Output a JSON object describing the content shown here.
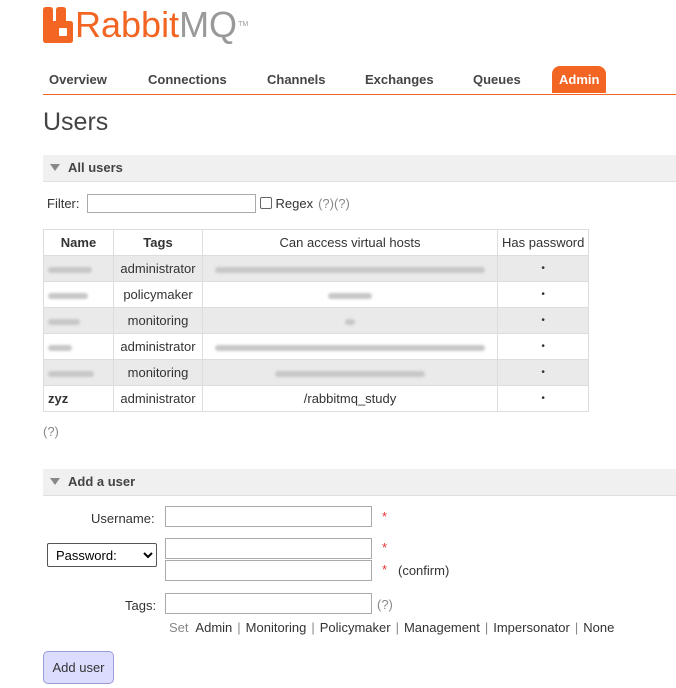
{
  "logo": {
    "rabbit": "Rabbit",
    "mq": "MQ",
    "tm": "TM"
  },
  "nav": {
    "overview": "Overview",
    "connections": "Connections",
    "channels": "Channels",
    "exchanges": "Exchanges",
    "queues": "Queues",
    "admin": "Admin"
  },
  "page_title": "Users",
  "all_users": {
    "header": "All users",
    "filter_label": "Filter:",
    "filter_value": "",
    "regex_label": "Regex",
    "regex_help": "(?)(?)",
    "columns": {
      "name": "Name",
      "tags": "Tags",
      "vhosts": "Can access virtual hosts",
      "has_password": "Has password"
    },
    "rows": [
      {
        "name": "",
        "tags": "administrator",
        "vhosts": "",
        "has_password": "•",
        "redacted": true
      },
      {
        "name": "",
        "tags": "policymaker",
        "vhosts": "",
        "has_password": "•",
        "redacted": true
      },
      {
        "name": "",
        "tags": "monitoring",
        "vhosts": "",
        "has_password": "•",
        "redacted": true
      },
      {
        "name": "",
        "tags": "administrator",
        "vhosts": "",
        "has_password": "•",
        "redacted": true
      },
      {
        "name": "",
        "tags": "monitoring",
        "vhosts": "",
        "has_password": "•",
        "redacted": true
      },
      {
        "name": "zyz",
        "tags": "administrator",
        "vhosts": "/rabbitmq_study",
        "has_password": "•",
        "redacted": false
      }
    ],
    "help": "(?)"
  },
  "add_user": {
    "header": "Add a user",
    "username_label": "Username:",
    "username_value": "",
    "password_select": "Password:",
    "password_value": "",
    "confirm_value": "",
    "confirm_label": "(confirm)",
    "required_mark": "*",
    "tags_label": "Tags:",
    "tags_value": "",
    "tags_help": "(?)",
    "set_label": "Set",
    "tag_options": [
      "Admin",
      "Monitoring",
      "Policymaker",
      "Management",
      "Impersonator",
      "None"
    ],
    "separator": "|",
    "submit_label": "Add user"
  },
  "colors": {
    "accent": "#f26522",
    "header_bg": "#f0f0f0",
    "button_bg": "#dcdcff",
    "required": "#e33"
  }
}
